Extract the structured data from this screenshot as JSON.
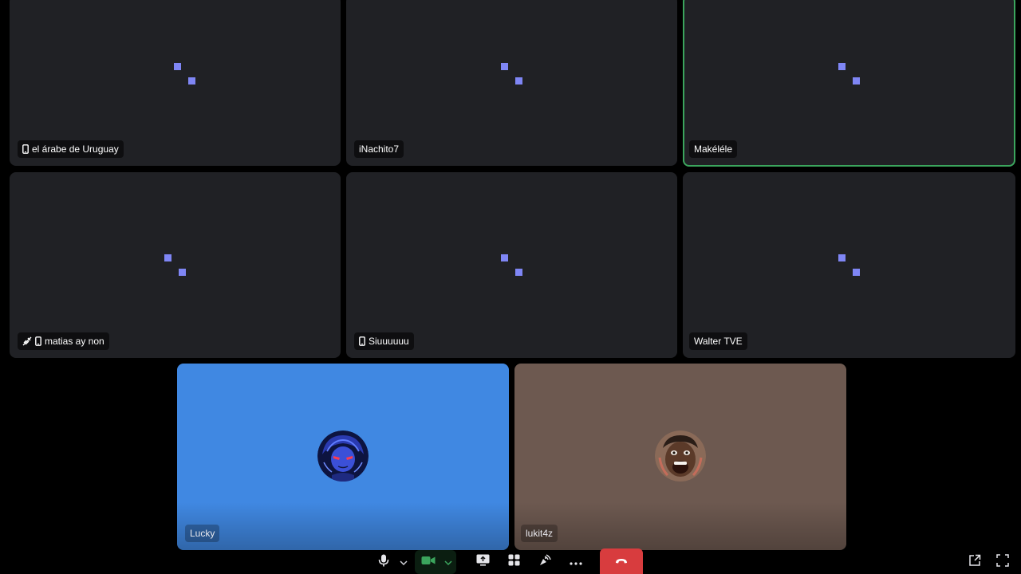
{
  "participants_grid": [
    {
      "name": "el árabe de Uruguay",
      "device_icon": "phone-icon",
      "muted": false,
      "speaking": false
    },
    {
      "name": "iNachito7",
      "device_icon": null,
      "muted": false,
      "speaking": false
    },
    {
      "name": "Makéléle",
      "device_icon": null,
      "muted": false,
      "speaking": true
    },
    {
      "name": "matias ay non",
      "device_icon": "phone-icon",
      "muted": true,
      "speaking": false
    },
    {
      "name": "Siuuuuuu",
      "device_icon": "phone-icon",
      "muted": false,
      "speaking": false
    },
    {
      "name": "Walter TVE",
      "device_icon": null,
      "muted": false,
      "speaking": false
    }
  ],
  "participants_bottom": [
    {
      "name": "Lucky",
      "background": "#4088e2",
      "avatar": "anime-avatar"
    },
    {
      "name": "lukit4z",
      "background": "#6d5950",
      "avatar": "face-avatar"
    }
  ],
  "controls": {
    "items": [
      "microphone-icon",
      "chevron-down-icon",
      "camera-icon",
      "chevron-down-icon",
      "screen-share-icon",
      "activities-icon",
      "soundboard-icon",
      "more-icon",
      "hangup-icon",
      "popout-icon",
      "fullscreen-icon"
    ]
  },
  "colors": {
    "tile_bg": "#202125",
    "loader": "#7f86f5",
    "speaking_ring": "#3ba55d",
    "hangup": "#d83c3e",
    "camera_active": "#3ba55d"
  }
}
